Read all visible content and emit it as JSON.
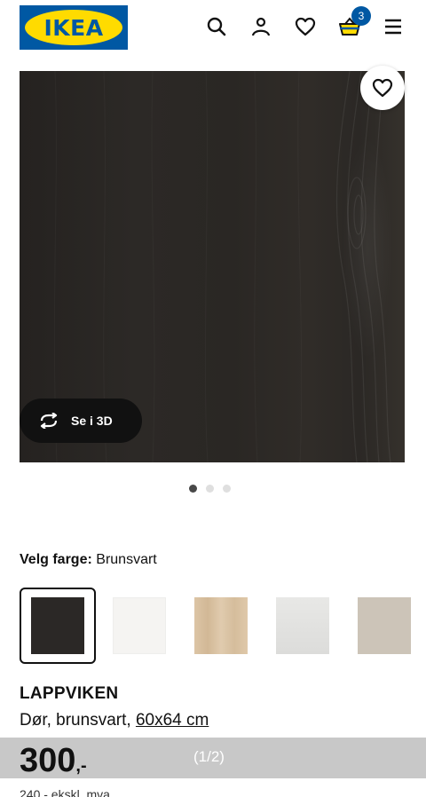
{
  "header": {
    "logo_text": "IKEA",
    "icons": [
      "search-icon",
      "user-icon",
      "heart-icon",
      "cart-icon",
      "menu-icon"
    ],
    "cart_count": "3",
    "colors": {
      "brand_blue": "#0058a3",
      "brand_yellow": "#ffdb00"
    }
  },
  "gallery": {
    "view_3d_label": "Se i 3D",
    "page_indicator": "(1/2)",
    "dots_total": 3,
    "dots_active": 1
  },
  "color_select": {
    "label": "Velg farge:",
    "value": "Brunsvart",
    "swatches": [
      {
        "name": "brunsvart",
        "color": "#2b2826",
        "selected": true
      },
      {
        "name": "white",
        "color": "#f5f4f2",
        "selected": false
      },
      {
        "name": "oak",
        "color": "#d9c2a4",
        "selected": false
      },
      {
        "name": "light-grey",
        "color": "#e2e2e0",
        "selected": false
      },
      {
        "name": "beige",
        "color": "#ccc4b8",
        "selected": false
      }
    ]
  },
  "product": {
    "name": "LAPPVIKEN",
    "description": "Dør, brunsvart,",
    "size": "60x64 cm"
  },
  "price": {
    "amount": "300",
    "suffix": ",-",
    "sub": "240,- ekskl. mva"
  }
}
